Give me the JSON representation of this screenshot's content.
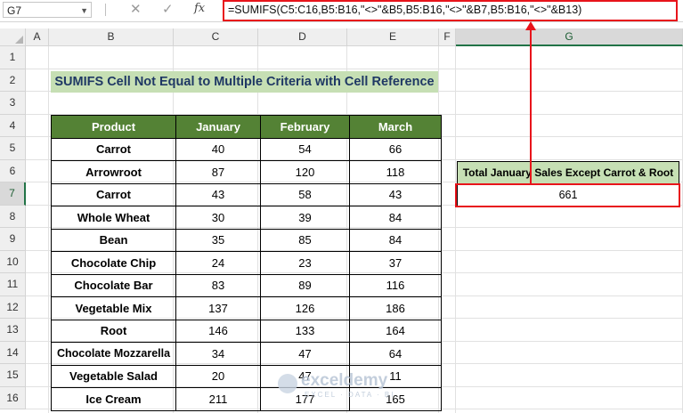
{
  "formula_bar": {
    "name_box": "G7",
    "cancel_icon": "✕",
    "enter_icon": "✓",
    "fx_label": "fx",
    "formula": "=SUMIFS(C5:C16,B5:B16,\"<>\"&B5,B5:B16,\"<>\"&B7,B5:B16,\"<>\"&B13)"
  },
  "columns": [
    "A",
    "B",
    "C",
    "D",
    "E",
    "F",
    "G"
  ],
  "rows": [
    "1",
    "2",
    "3",
    "4",
    "5",
    "6",
    "7",
    "8",
    "9",
    "10",
    "11",
    "12",
    "13",
    "14",
    "15",
    "16"
  ],
  "title": "SUMIFS Cell Not Equal to Multiple Criteria with Cell Reference",
  "table": {
    "headers": [
      "Product",
      "January",
      "February",
      "March"
    ],
    "rows": [
      [
        "Carrot",
        "40",
        "54",
        "66"
      ],
      [
        "Arrowroot",
        "87",
        "120",
        "118"
      ],
      [
        "Carrot",
        "43",
        "58",
        "43"
      ],
      [
        "Whole Wheat",
        "30",
        "39",
        "84"
      ],
      [
        "Bean",
        "35",
        "85",
        "84"
      ],
      [
        "Chocolate Chip",
        "24",
        "23",
        "37"
      ],
      [
        "Chocolate Bar",
        "83",
        "89",
        "116"
      ],
      [
        "Vegetable Mix",
        "137",
        "126",
        "186"
      ],
      [
        "Root",
        "146",
        "133",
        "164"
      ],
      [
        "Chocolate Mozzarella",
        "34",
        "47",
        "64"
      ],
      [
        "Vegetable Salad",
        "20",
        "47",
        "11"
      ],
      [
        "Ice Cream",
        "211",
        "177",
        "165"
      ]
    ]
  },
  "result": {
    "label": "Total January Sales Except Carrot & Root",
    "value": "661"
  },
  "watermark": {
    "brand": "exceldemy",
    "tagline": "EXCEL · DATA · BI"
  },
  "colors": {
    "header_green": "#548235",
    "title_bg": "#c6dfb4",
    "highlight_red": "#e8141b"
  }
}
